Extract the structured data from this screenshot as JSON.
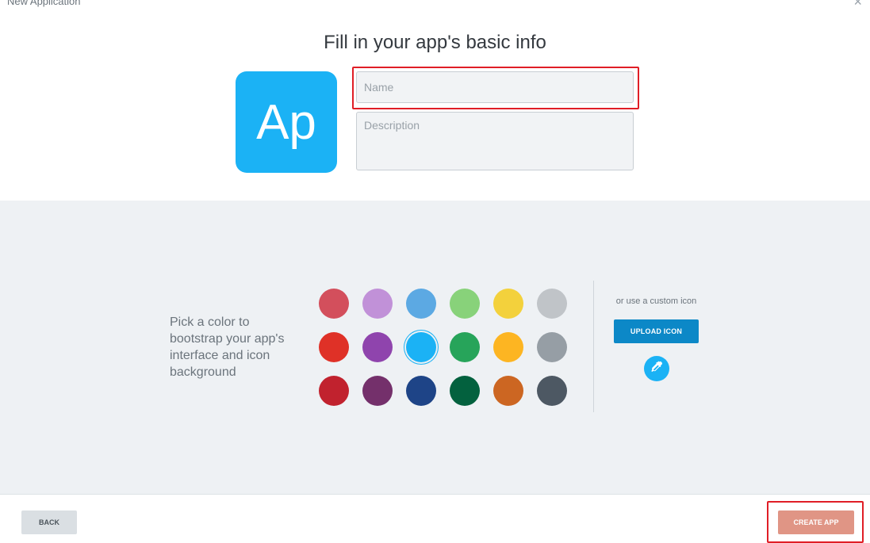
{
  "dialog": {
    "title": "New Application",
    "close_symbol": "×"
  },
  "header": {
    "title": "Fill in your app's basic info"
  },
  "app_icon": {
    "text": "Ap",
    "color": "#1bb2f5"
  },
  "form": {
    "name_placeholder": "Name",
    "name_value": "",
    "description_placeholder": "Description",
    "description_value": ""
  },
  "colors": {
    "prompt": "Pick a color to bootstrap your app's interface and icon background",
    "selected": "#1bb2f5",
    "swatches": [
      [
        "#d34f5c",
        "#c191d8",
        "#5ca9e3",
        "#88d27a",
        "#f3d13c",
        "#c0c4c8"
      ],
      [
        "#df3127",
        "#8f44ad",
        "#1bb2f5",
        "#27a45a",
        "#fdb522",
        "#969ea5"
      ],
      [
        "#c1222e",
        "#74306b",
        "#1e4487",
        "#03613e",
        "#cc6622",
        "#4d5863"
      ]
    ]
  },
  "custom_icon": {
    "label": "or use a custom icon",
    "upload_label": "UPLOAD ICON",
    "picker_icon": "eyedropper-icon"
  },
  "footer": {
    "back_label": "BACK",
    "create_label": "CREATE APP"
  },
  "highlight_color": "#e01e26"
}
